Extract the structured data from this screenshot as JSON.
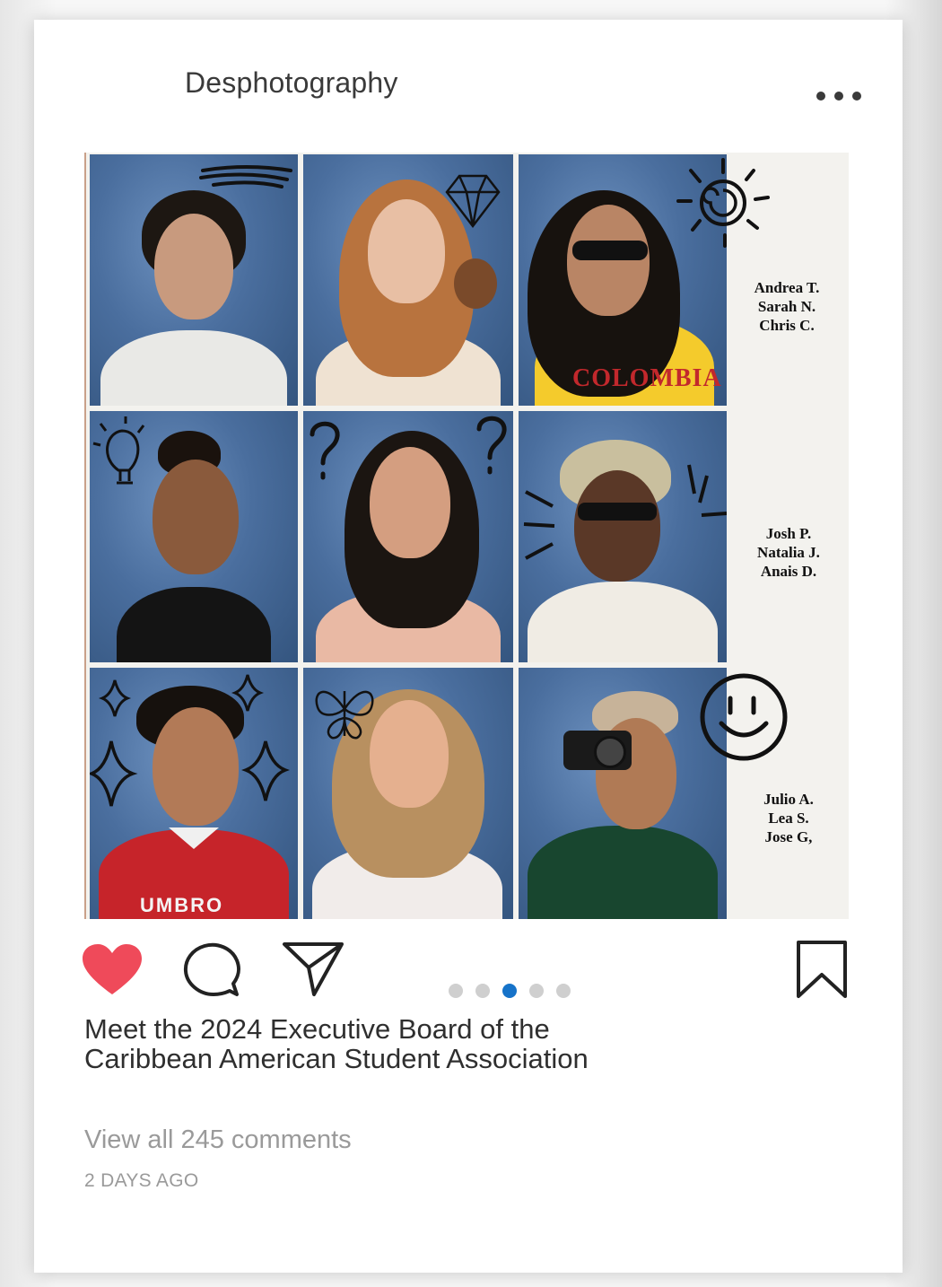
{
  "post": {
    "username": "Desphotography",
    "more_icon": "more-horizontal-icon",
    "caption_line1": "Meet the 2024 Executive Board of the",
    "caption_line2": "Caribbean American Student Association",
    "comments_link": "View all 245 comments",
    "timestamp": "2 DAYS AGO"
  },
  "photo": {
    "column_names": [
      [
        "Andrea T.",
        "Sarah N.",
        "Chris C."
      ],
      [
        "Josh P.",
        "Natalia J.",
        "Anais D."
      ],
      [
        "Julio A.",
        "Lea S.",
        "Jose G,"
      ]
    ],
    "shirt_texts": {
      "colombia": "COLOMBIA",
      "umbro": "UMBRO"
    }
  },
  "actions": {
    "like_icon": "heart-icon",
    "like_active": true,
    "comment_icon": "comment-bubble-icon",
    "share_icon": "paper-plane-icon",
    "save_icon": "bookmark-icon",
    "carousel": {
      "total": 5,
      "active_index": 2
    }
  },
  "colors": {
    "heart": "#ef4a5a",
    "carousel_active": "#1673c9",
    "carousel_inactive": "#cfcfcf",
    "text_primary": "#2f2f2f",
    "text_muted": "#9a9a9a"
  }
}
